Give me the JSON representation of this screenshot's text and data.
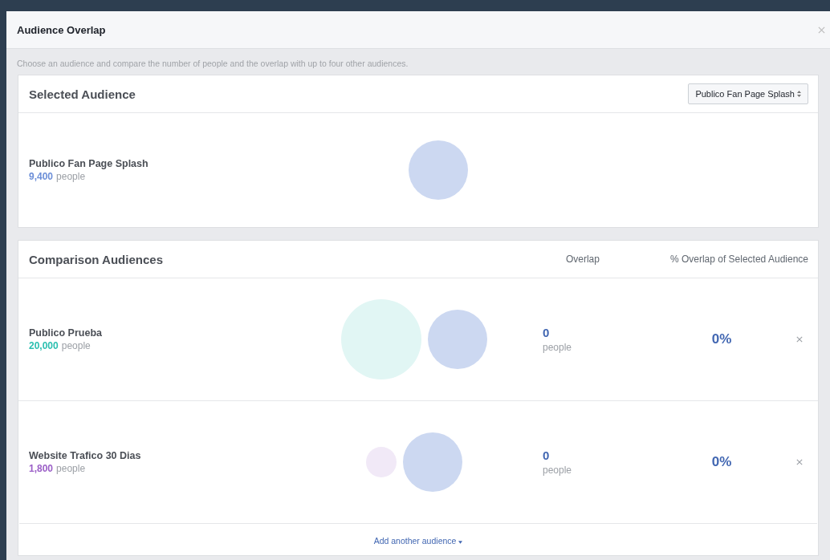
{
  "dialog": {
    "title": "Audience Overlap",
    "description": "Choose an audience and compare the number of people and the overlap with up to four other audiences."
  },
  "selected_audience": {
    "heading": "Selected Audience",
    "dropdown": "Publico Fan Page Splash",
    "name": "Publico Fan Page Splash",
    "count": "9,400",
    "unit": "people",
    "color": "#6d8fd8"
  },
  "comparison": {
    "heading": "Comparison Audiences",
    "columns": [
      "Overlap",
      "% Overlap of Selected Audience"
    ],
    "rows": [
      {
        "name": "Publico Prueba",
        "count": "20,000",
        "unit": "people",
        "color": "#2bbfb0",
        "overlap": "0",
        "overlap_unit": "people",
        "percent": "0%"
      },
      {
        "name": "Website Trafico 30 Dias",
        "count": "1,800",
        "unit": "people",
        "color": "#9b5fc7",
        "overlap": "0",
        "overlap_unit": "people",
        "percent": "0%"
      }
    ],
    "add_link": "Add another audience"
  }
}
